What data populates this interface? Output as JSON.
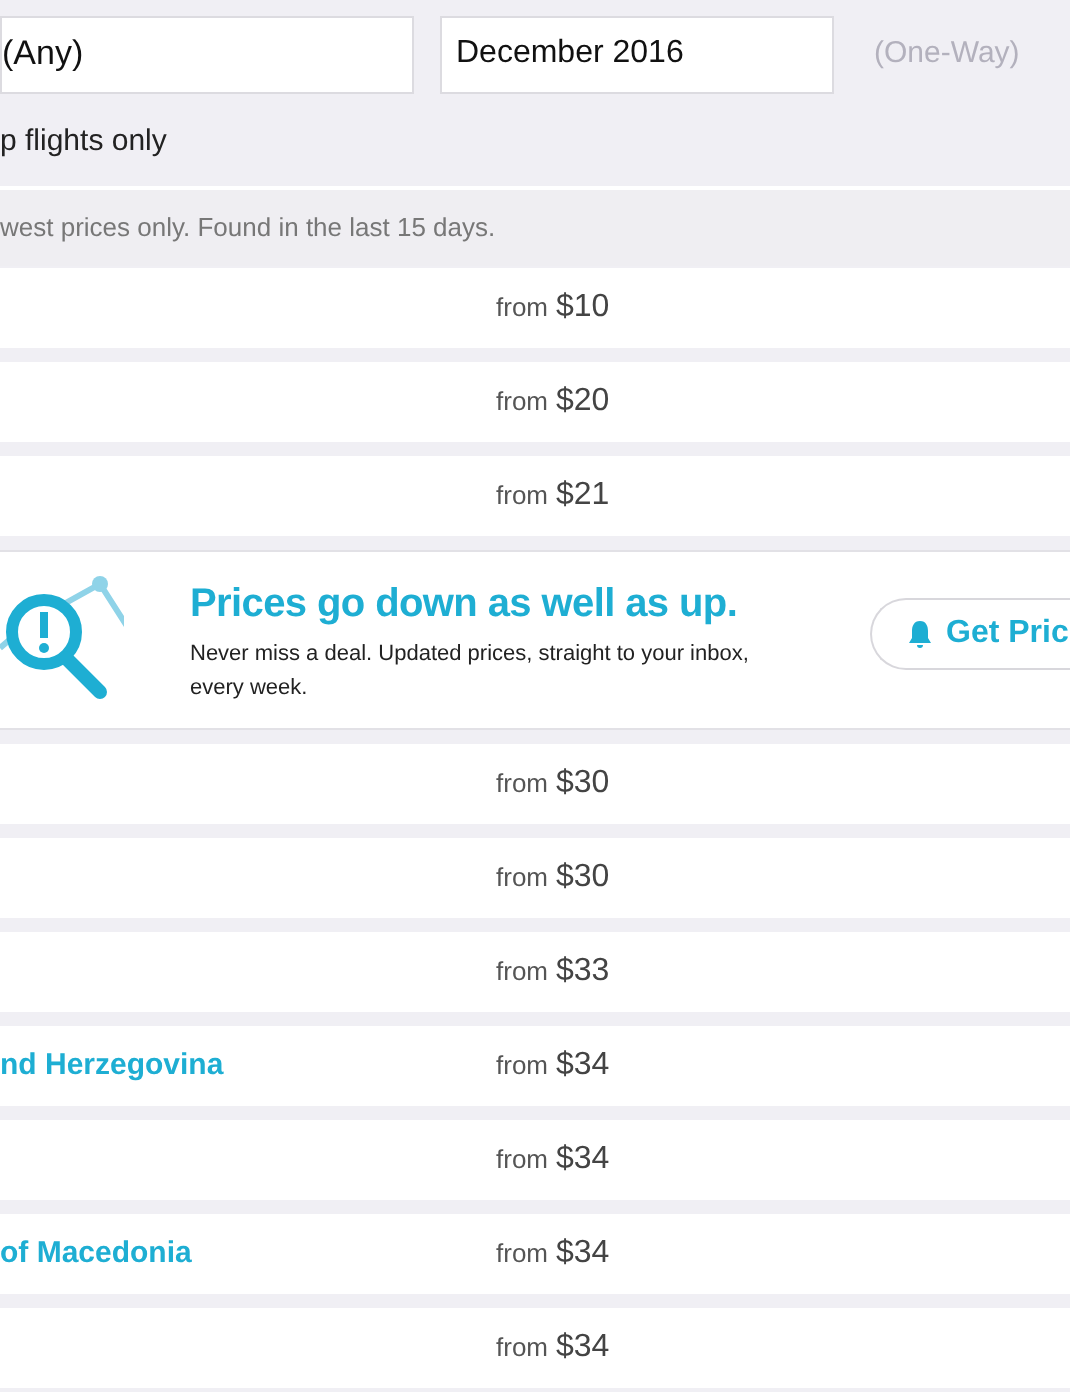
{
  "search": {
    "destination": "(Any)",
    "month": "December 2016",
    "trip_type": "(One-Way)",
    "option_label": "p flights only"
  },
  "notice": "west prices only. Found in the last 15 days.",
  "rows": [
    {
      "kind": "price",
      "price_prefix": "from",
      "price": "$10"
    },
    {
      "kind": "price",
      "price_prefix": "from",
      "price": "$20"
    },
    {
      "kind": "price",
      "price_prefix": "from",
      "price": "$21"
    },
    {
      "kind": "promo",
      "title": "Prices go down as well as up.",
      "text": "Never miss a deal. Updated prices, straight to your inbox, every week.",
      "button": "Get Pric"
    },
    {
      "kind": "price",
      "price_prefix": "from",
      "price": "$30"
    },
    {
      "kind": "price",
      "price_prefix": "from",
      "price": "$30"
    },
    {
      "kind": "price",
      "price_prefix": "from",
      "price": "$33"
    },
    {
      "kind": "price",
      "destination": "nd Herzegovina",
      "price_prefix": "from",
      "price": "$34"
    },
    {
      "kind": "price",
      "price_prefix": "from",
      "price": "$34"
    },
    {
      "kind": "price",
      "destination": "of Macedonia",
      "price_prefix": "from",
      "price": "$34"
    },
    {
      "kind": "price",
      "price_prefix": "from",
      "price": "$34"
    }
  ]
}
